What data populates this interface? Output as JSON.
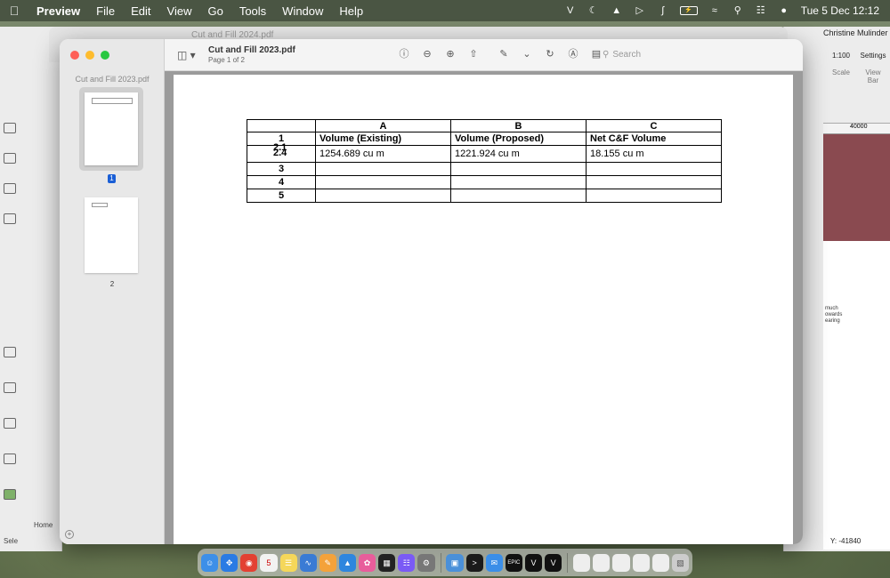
{
  "menubar": {
    "app_name": "Preview",
    "items": [
      "File",
      "Edit",
      "View",
      "Go",
      "Tools",
      "Window",
      "Help"
    ],
    "clock": "Tue 5 Dec  12:12"
  },
  "background_window": {
    "title": "Cut and Fill 2024.pdf"
  },
  "right_app": {
    "user": "Christine Mulinder",
    "scale_value": "1:100",
    "scale_label": "Scale",
    "settings_label": "Settings",
    "view_bar_label": "View Bar",
    "ruler_value": "40000",
    "note_text": "much\nowards\nearing",
    "y_coord": "Y: -41840"
  },
  "left_app": {
    "bottom_label": "Home",
    "select_label": "Sele"
  },
  "sidebar": {
    "title": "Cut and Fill 2023.pdf",
    "pages": [
      "1",
      "2"
    ]
  },
  "toolbar": {
    "doc_title": "Cut and Fill 2023.pdf",
    "page_info": "Page 1 of 2",
    "search_placeholder": "Search"
  },
  "document": {
    "columns": [
      "A",
      "B",
      "C"
    ],
    "row_labels": [
      "1",
      "2.1",
      "2.4",
      "3",
      "4",
      "5"
    ],
    "header_row": [
      "Volume (Existing)",
      "Volume (Proposed)",
      "Net C&F Volume"
    ],
    "value_row": [
      "1254.689  cu m",
      "1221.924  cu m",
      "18.155  cu m"
    ]
  },
  "colors": {
    "close": "#fe5f57",
    "minimize": "#febc2e",
    "zoom": "#28c840",
    "selection": "#1a5fd6",
    "wall_block": "#8a4a50"
  }
}
